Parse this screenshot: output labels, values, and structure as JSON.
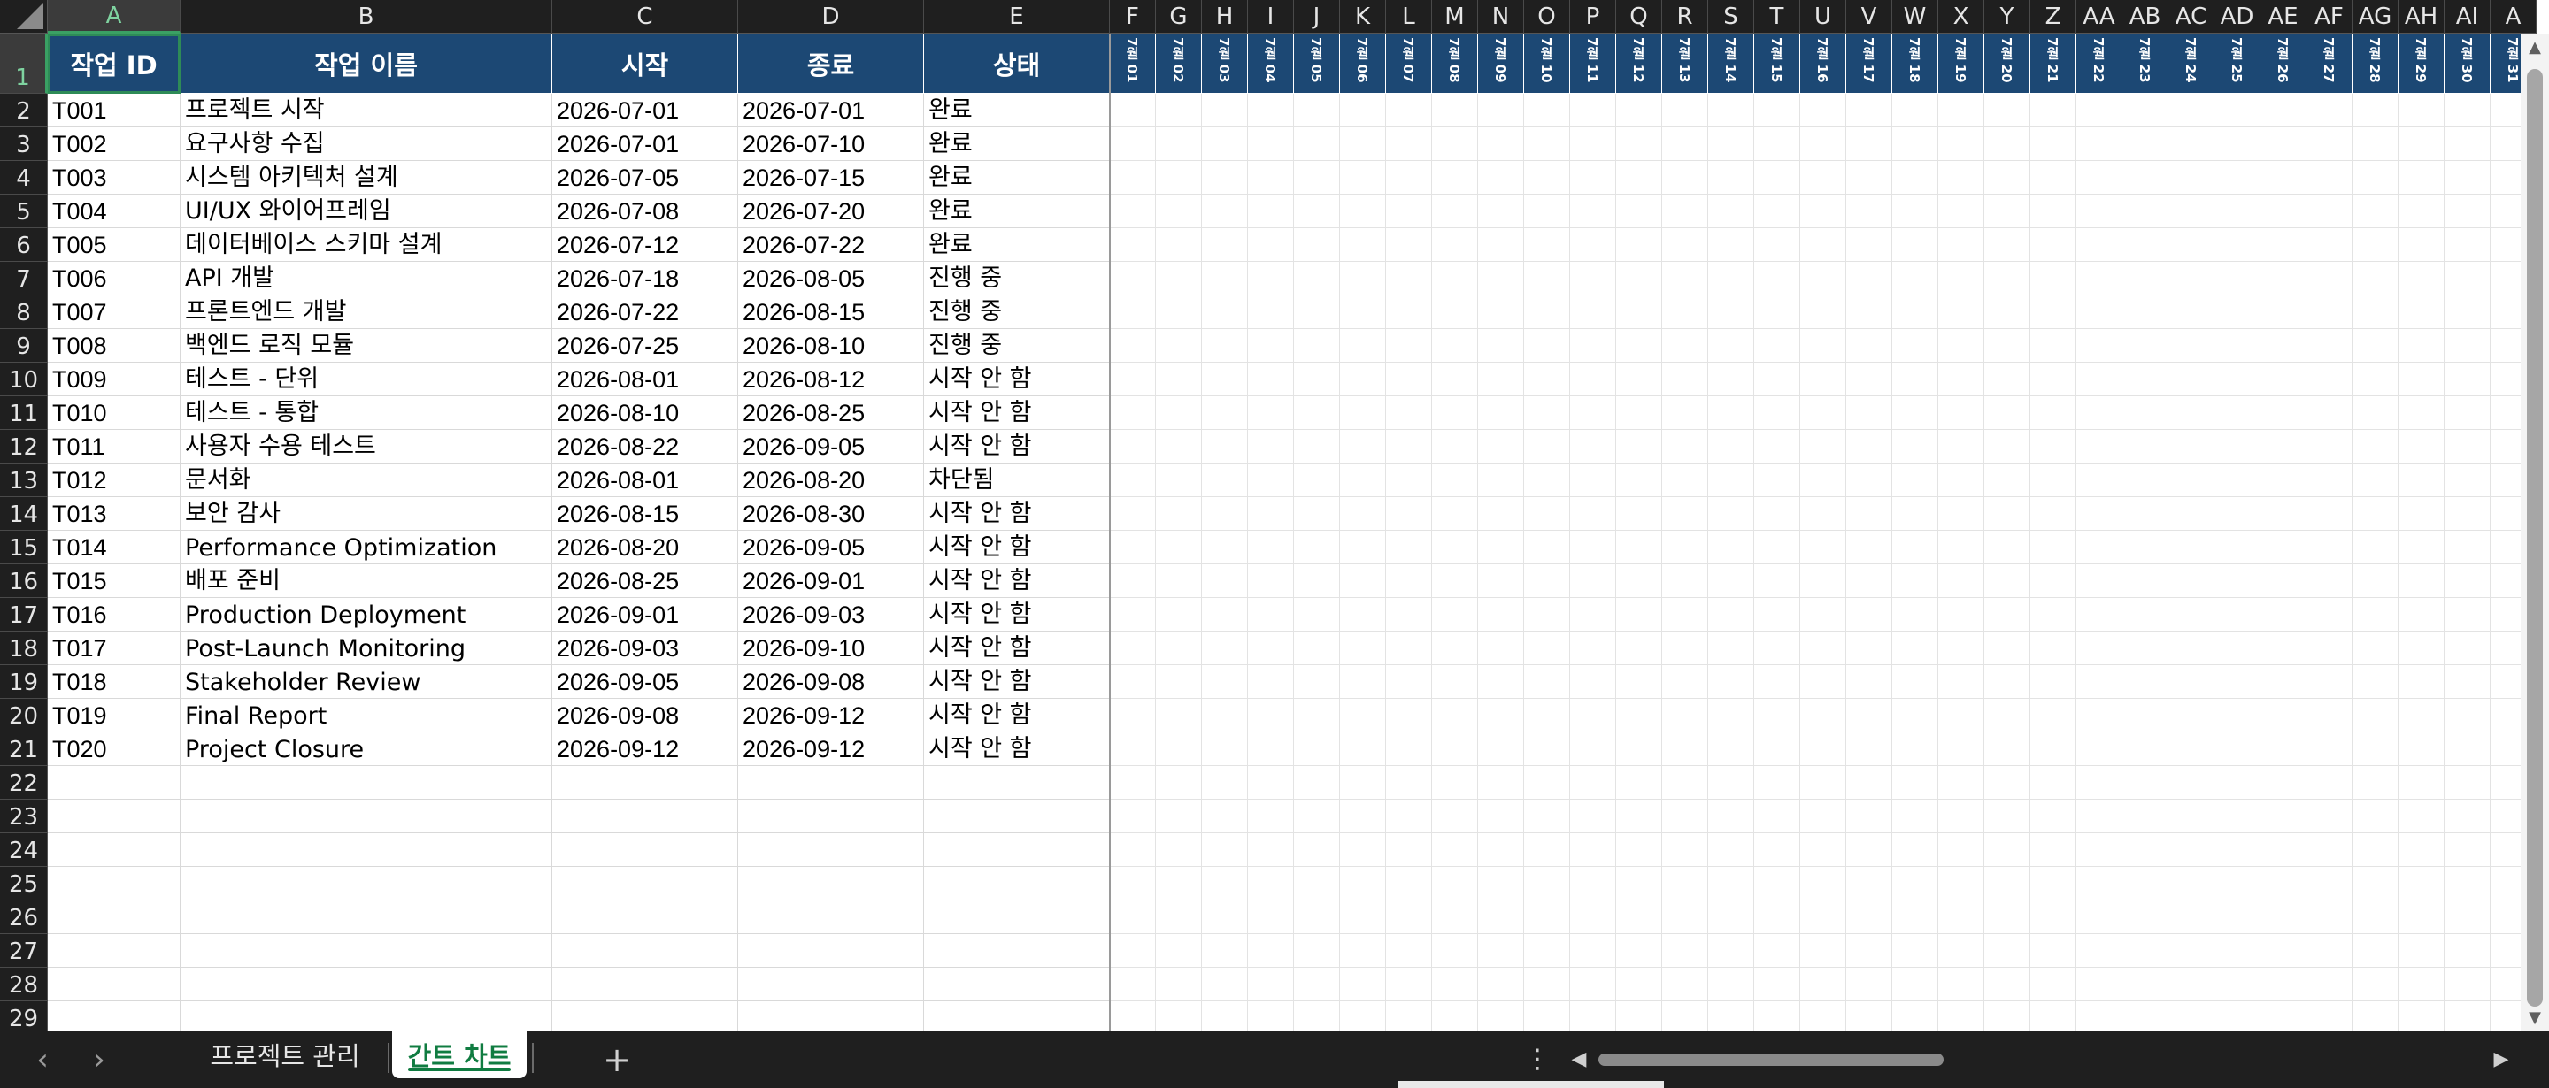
{
  "column_letters": [
    "A",
    "B",
    "C",
    "D",
    "E",
    "F",
    "G",
    "H",
    "I",
    "J",
    "K",
    "L",
    "M",
    "N",
    "O",
    "P",
    "Q",
    "R",
    "S",
    "T",
    "U",
    "V",
    "W",
    "X",
    "Y",
    "Z",
    "AA",
    "AB",
    "AC",
    "AD",
    "AE",
    "AF",
    "AG",
    "AH",
    "AI",
    "A"
  ],
  "row_numbers": [
    "1",
    "2",
    "3",
    "4",
    "5",
    "6",
    "7",
    "8",
    "9",
    "10",
    "11",
    "12",
    "13",
    "14",
    "15",
    "16",
    "17",
    "18",
    "19",
    "20",
    "21",
    "22",
    "23",
    "24",
    "25",
    "26",
    "27",
    "28",
    "29"
  ],
  "selected_column": "A",
  "selected_row": "1",
  "header": {
    "task_id": "작업 ID",
    "task_name": "작업 이름",
    "start": "시작",
    "end": "종료",
    "status": "상태"
  },
  "date_headers": [
    "7월 01",
    "7월 02",
    "7월 03",
    "7월 04",
    "7월 05",
    "7월 06",
    "7월 07",
    "7월 08",
    "7월 09",
    "7월 10",
    "7월 11",
    "7월 12",
    "7월 13",
    "7월 14",
    "7월 15",
    "7월 16",
    "7월 17",
    "7월 18",
    "7월 19",
    "7월 20",
    "7월 21",
    "7월 22",
    "7월 23",
    "7월 24",
    "7월 25",
    "7월 26",
    "7월 27",
    "7월 28",
    "7월 29",
    "7월 30",
    "7월 31"
  ],
  "tasks": [
    {
      "id": "T001",
      "name": "프로젝트 시작",
      "start": "2026-07-01",
      "end": "2026-07-01",
      "status": "완료"
    },
    {
      "id": "T002",
      "name": "요구사항 수집",
      "start": "2026-07-01",
      "end": "2026-07-10",
      "status": "완료"
    },
    {
      "id": "T003",
      "name": "시스템 아키텍처 설계",
      "start": "2026-07-05",
      "end": "2026-07-15",
      "status": "완료"
    },
    {
      "id": "T004",
      "name": "UI/UX 와이어프레임",
      "start": "2026-07-08",
      "end": "2026-07-20",
      "status": "완료"
    },
    {
      "id": "T005",
      "name": "데이터베이스 스키마 설계",
      "start": "2026-07-12",
      "end": "2026-07-22",
      "status": "완료"
    },
    {
      "id": "T006",
      "name": "API 개발",
      "start": "2026-07-18",
      "end": "2026-08-05",
      "status": "진행 중"
    },
    {
      "id": "T007",
      "name": "프론트엔드 개발",
      "start": "2026-07-22",
      "end": "2026-08-15",
      "status": "진행 중"
    },
    {
      "id": "T008",
      "name": "백엔드 로직 모듈",
      "start": "2026-07-25",
      "end": "2026-08-10",
      "status": "진행 중"
    },
    {
      "id": "T009",
      "name": "테스트 - 단위",
      "start": "2026-08-01",
      "end": "2026-08-12",
      "status": "시작 안 함"
    },
    {
      "id": "T010",
      "name": "테스트 - 통합",
      "start": "2026-08-10",
      "end": "2026-08-25",
      "status": "시작 안 함"
    },
    {
      "id": "T011",
      "name": "사용자 수용 테스트",
      "start": "2026-08-22",
      "end": "2026-09-05",
      "status": "시작 안 함"
    },
    {
      "id": "T012",
      "name": "문서화",
      "start": "2026-08-01",
      "end": "2026-08-20",
      "status": "차단됨"
    },
    {
      "id": "T013",
      "name": "보안 감사",
      "start": "2026-08-15",
      "end": "2026-08-30",
      "status": "시작 안 함"
    },
    {
      "id": "T014",
      "name": "Performance Optimization",
      "start": "2026-08-20",
      "end": "2026-09-05",
      "status": "시작 안 함"
    },
    {
      "id": "T015",
      "name": "배포 준비",
      "start": "2026-08-25",
      "end": "2026-09-01",
      "status": "시작 안 함"
    },
    {
      "id": "T016",
      "name": "Production Deployment",
      "start": "2026-09-01",
      "end": "2026-09-03",
      "status": "시작 안 함"
    },
    {
      "id": "T017",
      "name": "Post-Launch Monitoring",
      "start": "2026-09-03",
      "end": "2026-09-10",
      "status": "시작 안 함"
    },
    {
      "id": "T018",
      "name": "Stakeholder Review",
      "start": "2026-09-05",
      "end": "2026-09-08",
      "status": "시작 안 함"
    },
    {
      "id": "T019",
      "name": "Final Report",
      "start": "2026-09-08",
      "end": "2026-09-12",
      "status": "시작 안 함"
    },
    {
      "id": "T020",
      "name": "Project Closure",
      "start": "2026-09-12",
      "end": "2026-09-12",
      "status": "시작 안 함"
    }
  ],
  "sheet_tabs": [
    {
      "label": "프로젝트 관리",
      "active": false
    },
    {
      "label": "간트 차트",
      "active": true
    }
  ],
  "icons": {
    "prev_sheet": "chevron-left-icon",
    "next_sheet": "chevron-right-icon",
    "add_sheet": "plus-icon",
    "more": "more-vertical-icon"
  },
  "colors": {
    "header_fill": "#1c4874",
    "accent_green": "#107c41",
    "chrome_dark": "#1f1f1f"
  }
}
